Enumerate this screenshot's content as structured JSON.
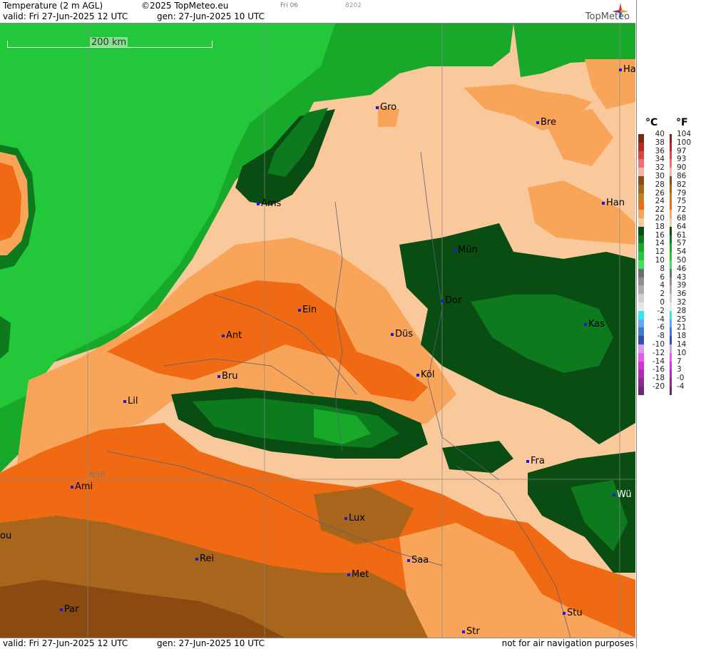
{
  "header": {
    "title": "Temperature (2 m AGL)",
    "copyright": "©2025 TopMeteo.eu",
    "run_tag": "Fri 06",
    "code": "8202",
    "valid": "valid:  Fri  27-Jun-2025  12 UTC",
    "gen": "gen:  27-Jun-2025 10 UTC",
    "brand": "TopMeteo"
  },
  "footer": {
    "valid": "valid:  Fri  27-Jun-2025  12 UTC",
    "gen": "gen:  27-Jun-2025 10 UTC",
    "disclaimer": "not for air navigation purposes"
  },
  "map": {
    "scale_label": "200 km",
    "grid_label": "N50",
    "cities": [
      "Gro",
      "Bre",
      "Ha",
      "Han",
      "Ams",
      "Mün",
      "Dor",
      "Ein",
      "Ant",
      "Düs",
      "Kas",
      "Köl",
      "Bru",
      "Lil",
      "Fra",
      "Ami",
      "Wü",
      "Lux",
      "Rei",
      "Saa",
      "Met",
      "ou",
      "Par",
      "Stu",
      "Str"
    ]
  },
  "legend": {
    "unit_c": "°C",
    "unit_f": "°F",
    "celsius": [
      "40",
      "38",
      "36",
      "34",
      "32",
      "30",
      "28",
      "26",
      "24",
      "22",
      "20",
      "18",
      "16",
      "14",
      "12",
      "10",
      "8",
      "6",
      "4",
      "2",
      "0",
      "-2",
      "-4",
      "-6",
      "-8",
      "-10",
      "-12",
      "-14",
      "-16",
      "-18",
      "-20"
    ],
    "fahrenheit": [
      "104",
      "100",
      "97",
      "93",
      "90",
      "86",
      "82",
      "79",
      "75",
      "72",
      "68",
      "64",
      "61",
      "57",
      "54",
      "50",
      "46",
      "43",
      "39",
      "36",
      "32",
      "28",
      "25",
      "21",
      "18",
      "14",
      "10",
      "7",
      "3",
      "-0",
      "-4"
    ],
    "colors": [
      "#7a2a10",
      "#b8281c",
      "#e0453b",
      "#f07070",
      "#f6b0a8",
      "#8a4a12",
      "#a8651c",
      "#c5801e",
      "#ef6a12",
      "#f8a55a",
      "#f9c89b",
      "#0a4d12",
      "#0d7a1e",
      "#18a82a",
      "#22c83a",
      "#3fe05a",
      "#6e6e6e",
      "#8e8e8e",
      "#acacac",
      "#cfcfcf",
      "#e6e6e6",
      "#35e6f0",
      "#5fa9f0",
      "#3e7ad6",
      "#2a52a8",
      "#d79be8",
      "#e85be8",
      "#d630d6",
      "#aa30b4",
      "#8e2a8e",
      "#6a2a72"
    ]
  }
}
